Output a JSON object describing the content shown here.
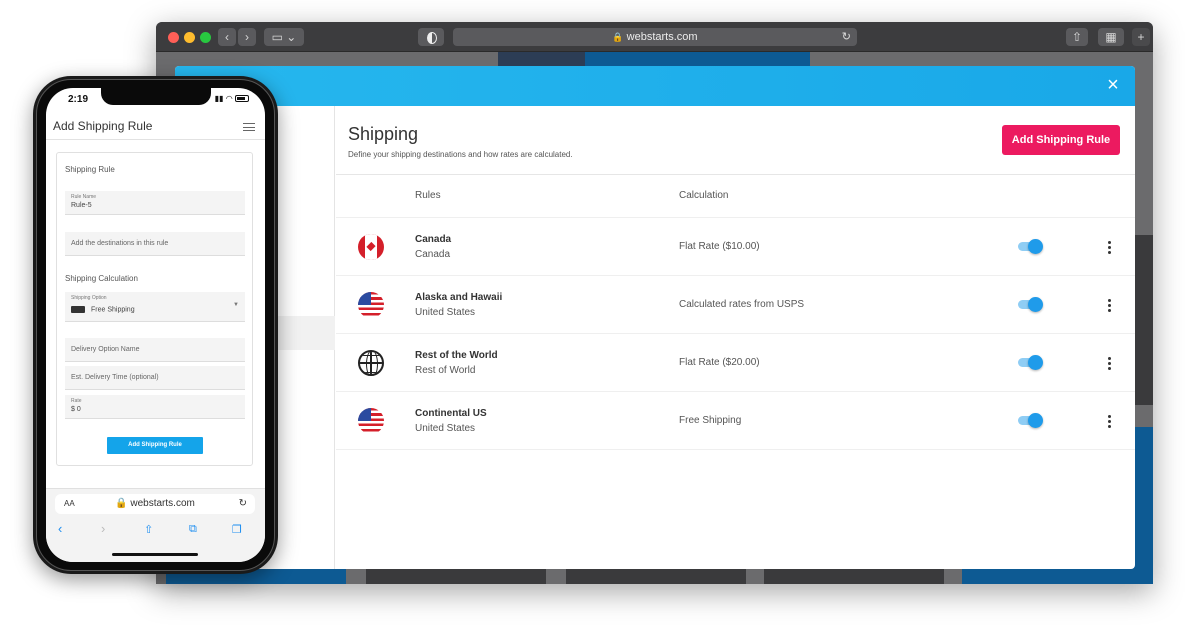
{
  "browser": {
    "address": "webstarts.com",
    "reload_icon": "reload-icon",
    "lock_icon": "lock-icon"
  },
  "modal": {
    "close_label": "×",
    "title": "Shipping",
    "subtitle": "Define your shipping destinations and how rates are calculated.",
    "add_button": "Add Shipping Rule",
    "columns": {
      "rules": "Rules",
      "calculation": "Calculation"
    },
    "rows": [
      {
        "name": "Canada",
        "region": "Canada",
        "calculation": "Flat Rate ($10.00)",
        "flag": "canada-flag-icon",
        "enabled": true
      },
      {
        "name": "Alaska and Hawaii",
        "region": "United States",
        "calculation": "Calculated rates from USPS",
        "flag": "us-flag-icon",
        "enabled": true
      },
      {
        "name": "Rest of the World",
        "region": "Rest of World",
        "calculation": "Flat Rate ($20.00)",
        "flag": "globe-icon",
        "enabled": true
      },
      {
        "name": "Continental US",
        "region": "United States",
        "calculation": "Free Shipping",
        "flag": "us-flag-icon",
        "enabled": true
      }
    ]
  },
  "phone": {
    "time": "2:19",
    "title": "Add Shipping Rule",
    "section_rule": "Shipping Rule",
    "rule_name_label": "Rule Name",
    "rule_name_value": "Rule-5",
    "destinations_placeholder": "Add the destinations in this rule",
    "section_calc": "Shipping Calculation",
    "option_label": "Shipping Option",
    "option_value": "Free Shipping",
    "delivery_name_placeholder": "Delivery Option Name",
    "delivery_time_placeholder": "Est. Delivery Time (optional)",
    "rate_label": "Rate",
    "rate_value": "$ 0",
    "submit": "Add Shipping Rule",
    "url_aa": "AA",
    "url_host": "webstarts.com",
    "reload": "↻"
  },
  "colors": {
    "header_blue": "#1fb0ec",
    "accent_pink": "#ec1a60",
    "toggle_blue": "#1f9bea",
    "phone_button": "#14a4ea"
  }
}
